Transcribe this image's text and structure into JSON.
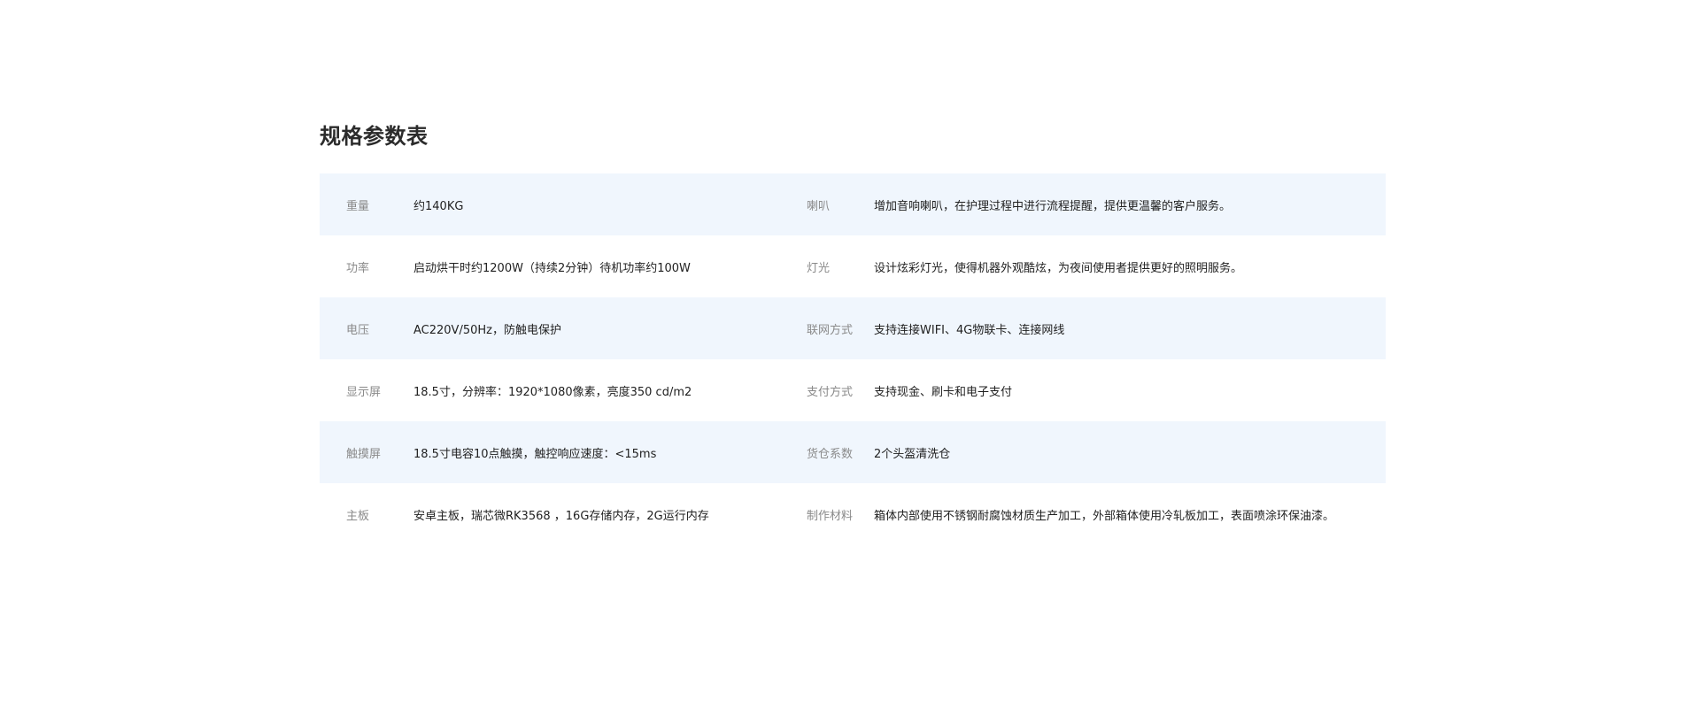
{
  "title": "规格参数表",
  "rows": [
    {
      "l_label": "重量",
      "l_value": "约140KG",
      "r_label": "喇叭",
      "r_value": "增加音响喇叭，在护理过程中进行流程提醒，提供更温馨的客户服务。"
    },
    {
      "l_label": "功率",
      "l_value": "启动烘干时约1200W（持续2分钟）待机功率约100W",
      "r_label": "灯光",
      "r_value": "设计炫彩灯光，使得机器外观酷炫，为夜间使用者提供更好的照明服务。"
    },
    {
      "l_label": "电压",
      "l_value": "AC220V/50Hz，防触电保护",
      "r_label": "联网方式",
      "r_value": "支持连接WIFI、4G物联卡、连接网线"
    },
    {
      "l_label": "显示屏",
      "l_value": "18.5寸，分辨率：1920*1080像素，亮度350 cd/m2",
      "r_label": "支付方式",
      "r_value": "支持现金、刷卡和电子支付"
    },
    {
      "l_label": "触摸屏",
      "l_value": "18.5寸电容10点触摸，触控响应速度：<15ms",
      "r_label": "货仓系数",
      "r_value": "2个头盔清洗仓"
    },
    {
      "l_label": "主板",
      "l_value": "安卓主板，瑞芯微RK3568 ，16G存储内存，2G运行内存",
      "r_label": "制作材料",
      "r_value": "箱体内部使用不锈钢耐腐蚀材质生产加工，外部箱体使用冷轧板加工，表面喷涂环保油漆。"
    }
  ],
  "colors": {
    "row_shade": "#f0f6fd",
    "label": "#8a8a8a",
    "value": "#1f1f1f",
    "title": "#2b2b2b"
  }
}
